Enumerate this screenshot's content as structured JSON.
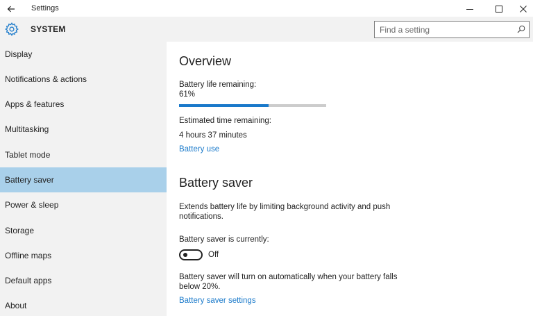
{
  "window": {
    "title": "Settings",
    "controls": [
      "minimize-icon",
      "maximize-icon",
      "close-icon"
    ]
  },
  "header": {
    "section_title": "SYSTEM",
    "icon": "gear-icon",
    "search_placeholder": "Find a setting"
  },
  "sidebar": {
    "items": [
      {
        "label": "Display",
        "active": false
      },
      {
        "label": "Notifications & actions",
        "active": false
      },
      {
        "label": "Apps & features",
        "active": false
      },
      {
        "label": "Multitasking",
        "active": false
      },
      {
        "label": "Tablet mode",
        "active": false
      },
      {
        "label": "Battery saver",
        "active": true
      },
      {
        "label": "Power & sleep",
        "active": false
      },
      {
        "label": "Storage",
        "active": false
      },
      {
        "label": "Offline maps",
        "active": false
      },
      {
        "label": "Default apps",
        "active": false
      },
      {
        "label": "About",
        "active": false
      }
    ]
  },
  "overview": {
    "heading": "Overview",
    "battery_label": "Battery life remaining:",
    "battery_percent_text": "61%",
    "battery_level": 0.61,
    "estimated_label": "Estimated time remaining:",
    "estimated_value": "4 hours 37 minutes",
    "battery_use_link": "Battery use"
  },
  "battery_saver": {
    "heading": "Battery saver",
    "description": "Extends battery life by limiting background activity and push notifications.",
    "status_label": "Battery saver is currently:",
    "toggle_state": "Off",
    "auto_text": "Battery saver will turn on automatically when your battery falls below 20%.",
    "settings_link": "Battery saver settings"
  },
  "colors": {
    "accent": "#1979ca",
    "selected_nav": "#a9d0ea",
    "sidebar_bg": "#f2f2f2"
  }
}
